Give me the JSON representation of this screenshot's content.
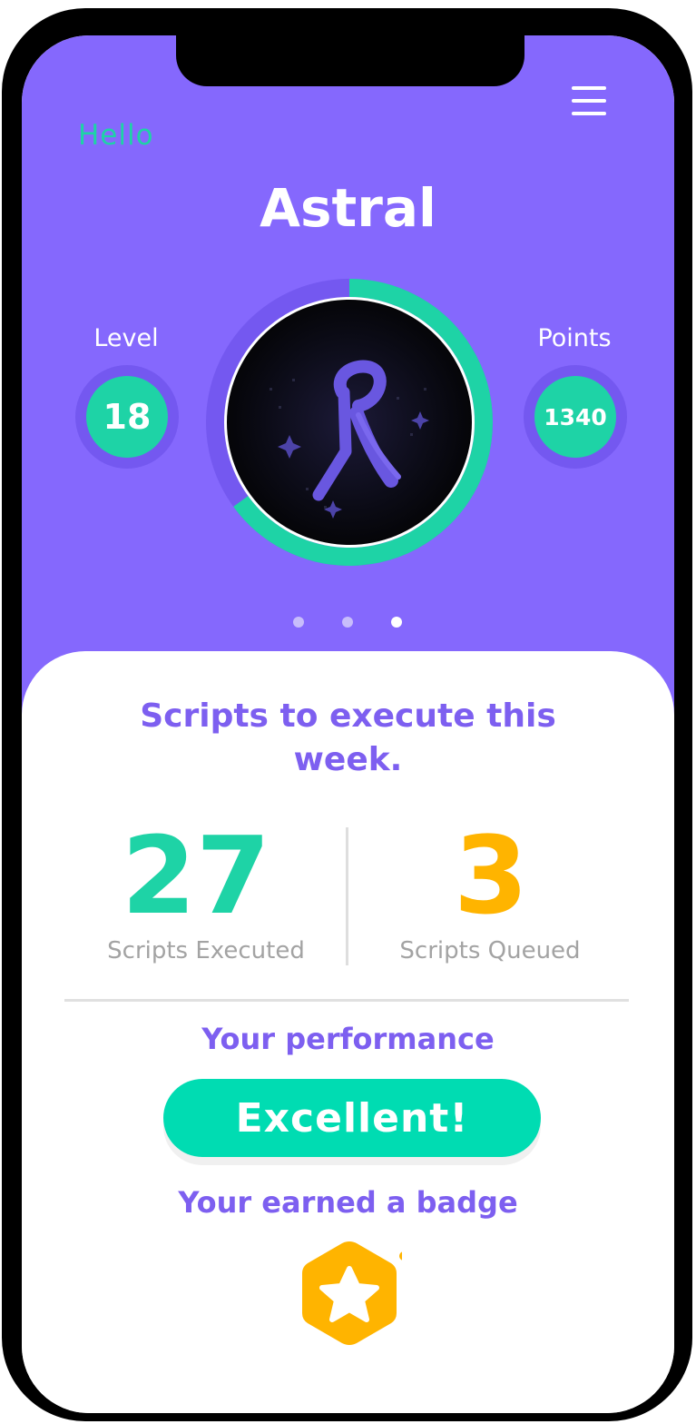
{
  "header": {
    "greeting": "Hello",
    "username": "Astral",
    "menu_icon": "hamburger-menu-icon"
  },
  "stats": {
    "level_label": "Level",
    "level_value": "18",
    "points_label": "Points",
    "points_value": "1340"
  },
  "avatar": {
    "icon": "r-logo-avatar",
    "progress_fraction": 0.65
  },
  "pager": {
    "count": 3,
    "active_index": 2
  },
  "weekly": {
    "title_line1": "Scripts to execute this",
    "title_line2": "week.",
    "executed_value": "27",
    "executed_label": "Scripts Executed",
    "queued_value": "3",
    "queued_label": "Scripts Queued"
  },
  "performance": {
    "title": "Your performance",
    "rating": "Excellent!"
  },
  "badge": {
    "title": "Your earned a badge",
    "icon": "star-badge-icon"
  },
  "colors": {
    "primary_purple": "#8568fd",
    "accent_teal": "#1ed3a6",
    "button_teal": "#00dcb2",
    "accent_orange": "#ffb400",
    "heading_purple": "#7d5ff0"
  }
}
